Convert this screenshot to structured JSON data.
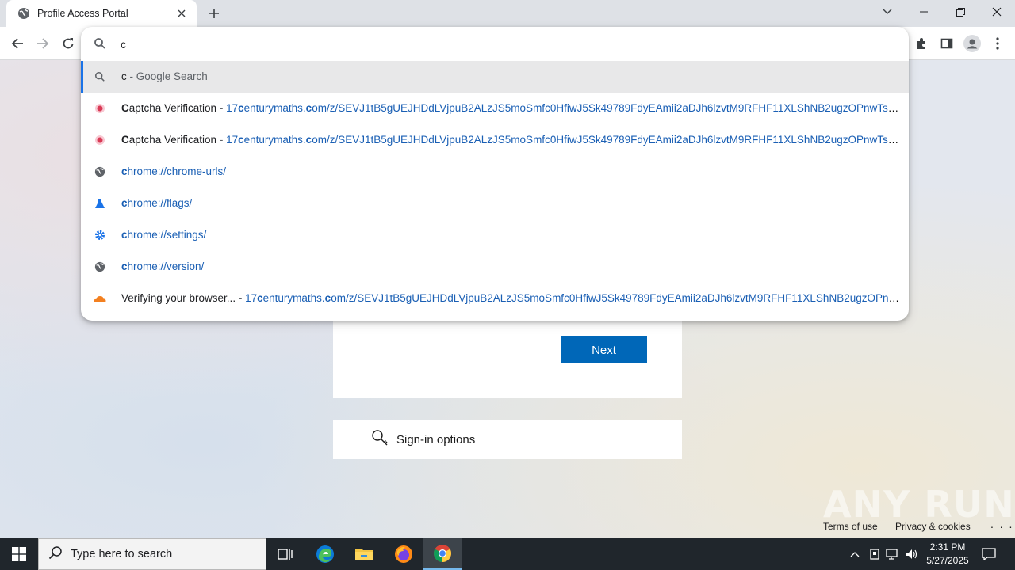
{
  "browser": {
    "tab": {
      "title": "Profile Access Portal"
    },
    "window_controls": [
      "minimize",
      "restore",
      "close"
    ]
  },
  "omnibox": {
    "query": "c",
    "suggestions": [
      {
        "icon": "search-icon",
        "title": "c",
        "sep": " - ",
        "desc": "Google Search",
        "selected": true
      },
      {
        "icon": "captcha-favicon",
        "title_bold": "C",
        "title_rest": "aptcha Verification",
        "sep": " - ",
        "url_pre": "17",
        "url_bold": "c",
        "url_mid": "enturymaths.",
        "url_bold2": "c",
        "url_rest": "om/z/SEVJ1tB5gUEJHDdLVjpuB2ALzJS5moSmfc0HfiwJ5Sk49789FdyEAmii2aDJh6lzvtM9RFHF11XLShNB2ugzOPnwTsQ..."
      },
      {
        "icon": "captcha-favicon",
        "title_bold": "C",
        "title_rest": "aptcha Verification",
        "sep": " - ",
        "url_pre": "17",
        "url_bold": "c",
        "url_mid": "enturymaths.",
        "url_bold2": "c",
        "url_rest": "om/z/SEVJ1tB5gUEJHDdLVjpuB2ALzJS5moSmfc0HfiwJ5Sk49789FdyEAmii2aDJh6lzvtM9RFHF11XLShNB2ugzOPnwTsQ..."
      },
      {
        "icon": "globe-icon",
        "url_bold": "c",
        "url_rest": "hrome://chrome-urls/"
      },
      {
        "icon": "flask-icon",
        "url_bold": "c",
        "url_rest": "hrome://flags/"
      },
      {
        "icon": "gear-icon",
        "url_bold": "c",
        "url_rest": "hrome://settings/"
      },
      {
        "icon": "globe-icon",
        "url_bold": "c",
        "url_rest": "hrome://version/"
      },
      {
        "icon": "cloud-icon",
        "title": "Verifying your browser...",
        "sep": " - ",
        "url_pre": "17",
        "url_bold": "c",
        "url_mid": "enturymaths.",
        "url_bold2": "c",
        "url_rest": "om/z/SEVJ1tB5gUEJHDdLVjpuB2ALzJS5moSmfc0HfiwJ5Sk49789FdyEAmii2aDJh6lzvtM9RFHF11XLShNB2ugzOPnw..."
      }
    ]
  },
  "page": {
    "next_label": "Next",
    "signin_options_label": "Sign-in options",
    "footer": {
      "terms": "Terms of use",
      "privacy": "Privacy & cookies",
      "more": ". . ."
    },
    "watermark": "ANY RUN"
  },
  "taskbar": {
    "search_placeholder": "Type here to search",
    "apps": [
      "task-view",
      "edge",
      "file-explorer",
      "firefox",
      "chrome"
    ],
    "clock": {
      "time": "2:31 PM",
      "date": "5/27/2025"
    }
  },
  "colors": {
    "accent_blue": "#0067b8",
    "link_blue": "#1a5fb4",
    "taskbar": "#20262c",
    "selected_bar": "#1a73e8"
  }
}
